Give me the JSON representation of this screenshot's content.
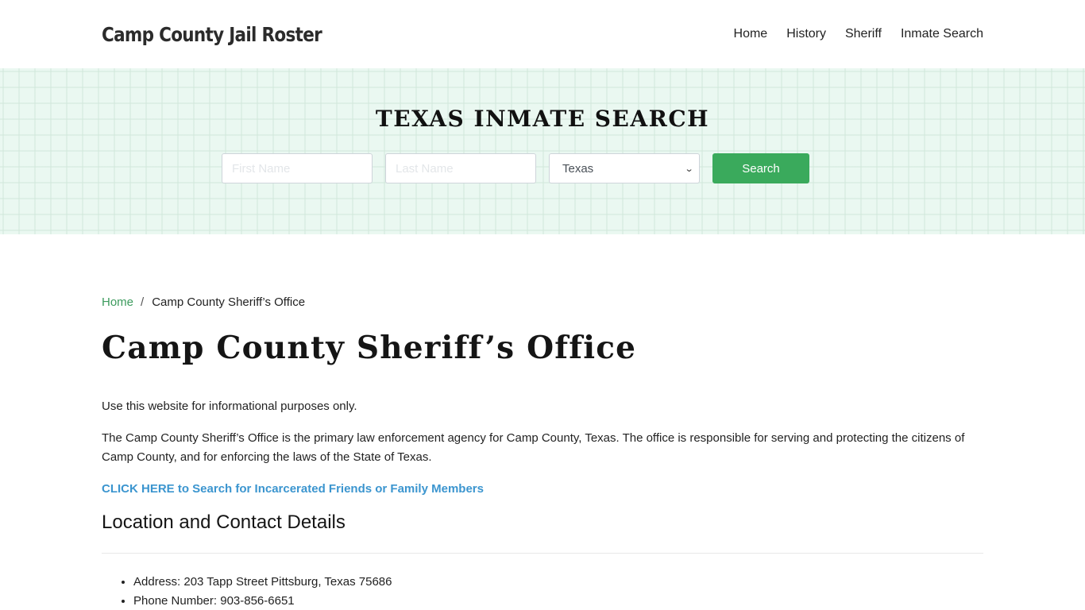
{
  "header": {
    "brand": "Camp County Jail Roster",
    "nav": [
      {
        "label": "Home"
      },
      {
        "label": "History"
      },
      {
        "label": "Sheriff"
      },
      {
        "label": "Inmate Search"
      }
    ]
  },
  "hero": {
    "title": "TEXAS INMATE SEARCH",
    "first_name_placeholder": "First Name",
    "last_name_placeholder": "Last Name",
    "first_name_value": "",
    "last_name_value": "",
    "state_selected": "Texas",
    "search_label": "Search",
    "accent_color": "#3aaa5c"
  },
  "breadcrumb": {
    "home": "Home",
    "separator": "/",
    "current": "Camp County Sheriff’s Office"
  },
  "main": {
    "title": "Camp County Sheriff’s Office",
    "disclaimer": "Use this website for informational purposes only.",
    "intro": "The Camp County Sheriff’s Office is the primary law enforcement agency for Camp County, Texas. The office is responsible for serving and protecting the citizens of Camp County, and for enforcing the laws of the State of Texas.",
    "cta_link": "CLICK HERE to Search for Incarcerated Friends or Family Members",
    "section_title": "Location and Contact Details",
    "details": [
      {
        "text": "Address: 203 Tapp Street Pittsburg, Texas 75686"
      },
      {
        "text": "Phone Number: 903-856-6651"
      }
    ]
  }
}
